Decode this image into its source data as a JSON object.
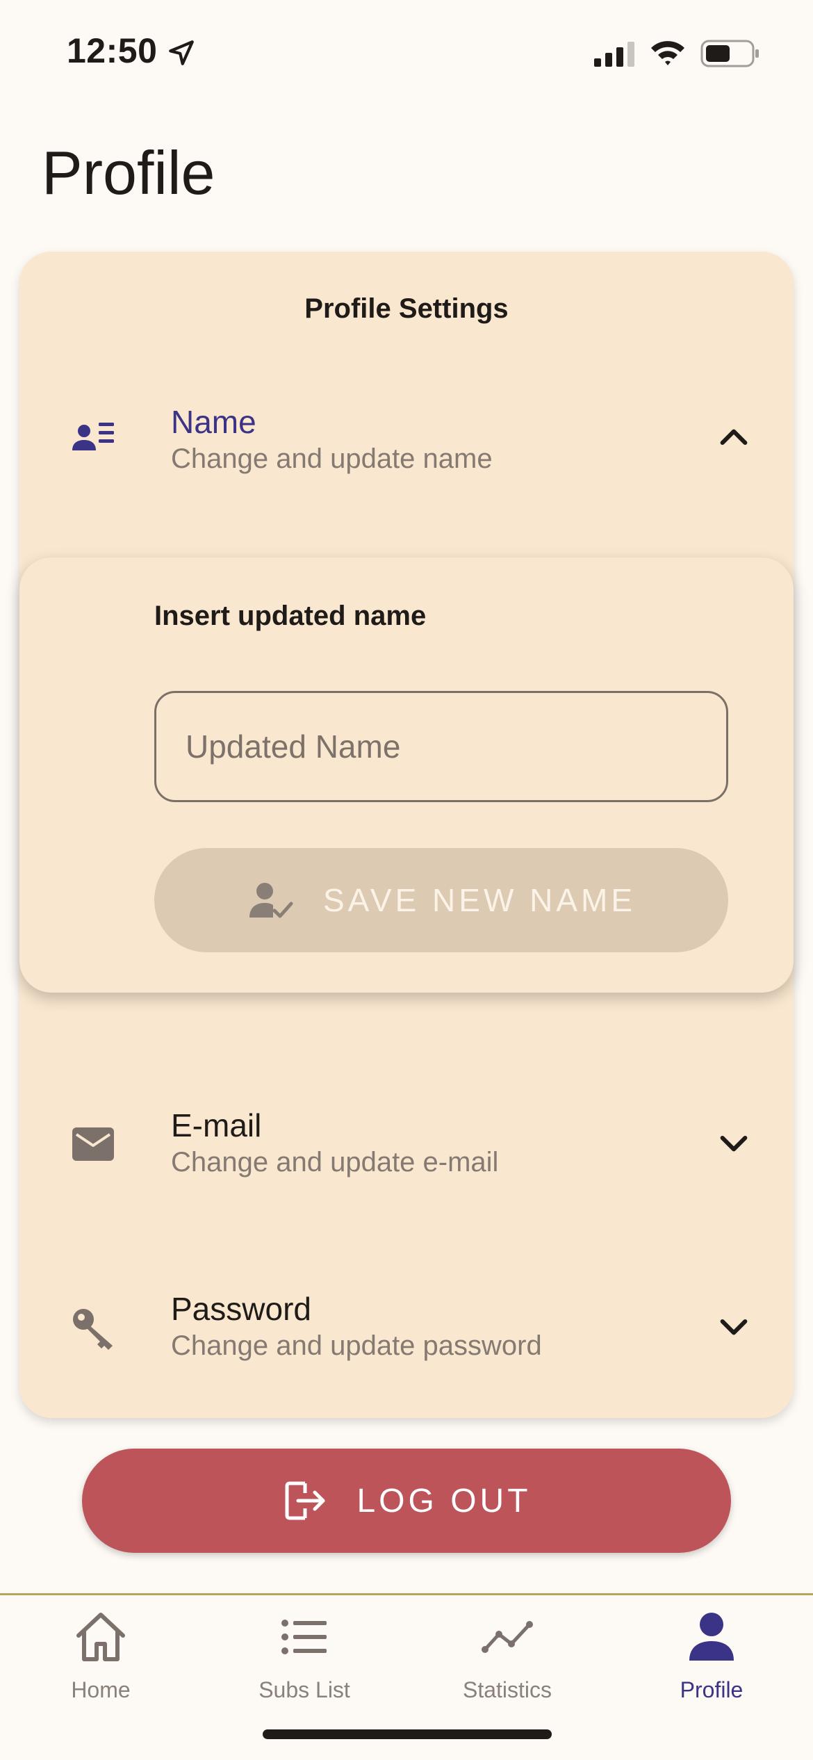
{
  "status_bar": {
    "time": "12:50"
  },
  "header": {
    "title": "Profile"
  },
  "settings": {
    "title": "Profile Settings",
    "name": {
      "title": "Name",
      "subtitle": "Change and update name",
      "expanded": true
    },
    "name_panel": {
      "label": "Insert updated name",
      "input_placeholder": "Updated Name",
      "input_value": "",
      "save_label": "SAVE NEW NAME"
    },
    "email": {
      "title": "E-mail",
      "subtitle": "Change and update e-mail",
      "expanded": false
    },
    "password": {
      "title": "Password",
      "subtitle": "Change and update password",
      "expanded": false
    }
  },
  "logout": {
    "label": "LOG OUT"
  },
  "nav": {
    "items": [
      {
        "label": "Home",
        "icon": "home-icon",
        "active": false
      },
      {
        "label": "Subs List",
        "icon": "list-icon",
        "active": false
      },
      {
        "label": "Statistics",
        "icon": "statistics-icon",
        "active": false
      },
      {
        "label": "Profile",
        "icon": "person-icon",
        "active": true
      }
    ]
  },
  "colors": {
    "accent": "#3b3486",
    "card": "#f9e7cf",
    "logout": "#bc545a",
    "save_disabled": "#dccab3",
    "nav_divider": "#b3a45e"
  }
}
